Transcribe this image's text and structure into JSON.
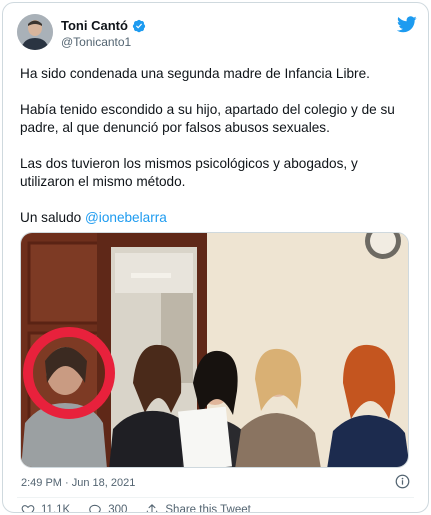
{
  "author": {
    "display_name": "Toni Cantó",
    "handle": "@Tonicanto1"
  },
  "tweet": {
    "paragraphs": [
      "Ha sido condenada una segunda madre de Infancia Libre.",
      "Había tenido escondido a su hijo, apartado del colegio y de su padre, al que denunció por falsos abusos sexuales.",
      "Las dos tuvieron los mismos psicológicos y abogados, y utilizaron el mismo método."
    ],
    "closing_prefix": "Un saludo ",
    "mention": "@ionebelarra"
  },
  "meta": {
    "timestamp": "2:49 PM · Jun 18, 2021"
  },
  "actions": {
    "likes": "11.1K",
    "replies": "300",
    "share_label": "Share this Tweet"
  },
  "icons": {
    "verified": "verified-badge-icon",
    "brand": "twitter-bird-icon",
    "info": "info-icon",
    "like": "heart-icon",
    "reply": "reply-bubble-icon",
    "share": "share-icon"
  },
  "colors": {
    "accent": "#1d9bf0",
    "text": "#0f1419",
    "muted": "#536471",
    "highlight_circle": "#e8213c"
  }
}
